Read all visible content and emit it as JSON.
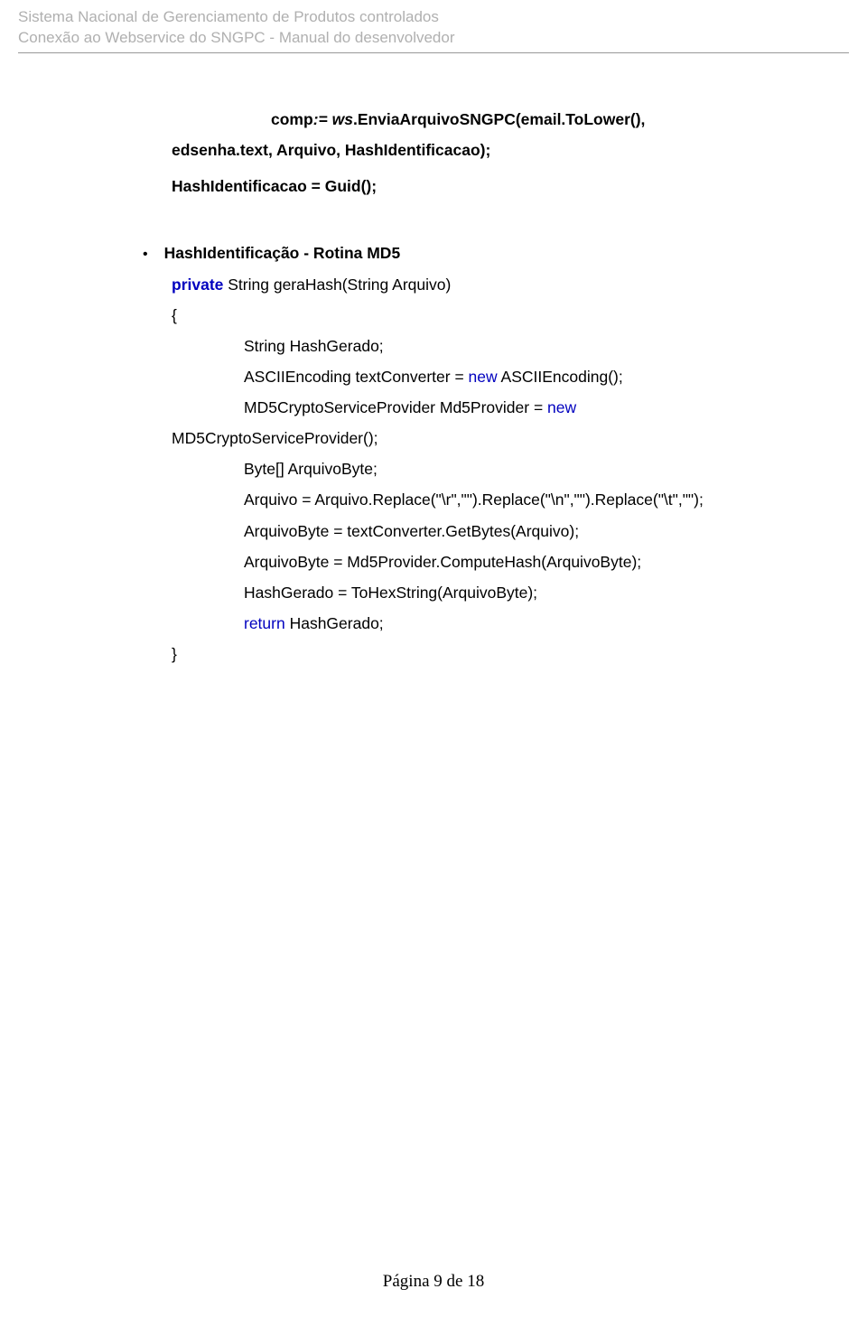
{
  "header": {
    "line1": "Sistema Nacional de Gerenciamento de Produtos controlados",
    "line2": "Conexão ao Webservice do SNGPC - Manual do desenvolvedor"
  },
  "intro": {
    "part1_prefix": "comp",
    "part1_italic": ":= ws",
    "part1_rest": ".EnviaArquivoSNGPC(email.ToLower(),",
    "part2": "edsenha.text, Arquivo, HashIdentificacao);",
    "part3": "HashIdentificacao = Guid();"
  },
  "bullet": {
    "title": "HashIdentificação - Rotina MD5"
  },
  "code": {
    "l1_kw": "private",
    "l1_rest": " String geraHash(String Arquivo)",
    "l2": "{",
    "l3": "String HashGerado;",
    "l4a": "ASCIIEncoding textConverter = ",
    "l4_kw": "new",
    "l4b": " ASCIIEncoding();",
    "l5a": "MD5CryptoServiceProvider Md5Provider = ",
    "l5_kw": "new",
    "l6": "MD5CryptoServiceProvider();",
    "l7": "Byte[] ArquivoByte;",
    "l8": "Arquivo = Arquivo.Replace(\"\\r\",\"\").Replace(\"\\n\",\"\").Replace(\"\\t\",\"\");",
    "l9": "ArquivoByte = textConverter.GetBytes(Arquivo);",
    "l10": "ArquivoByte = Md5Provider.ComputeHash(ArquivoByte);",
    "l11": "HashGerado = ToHexString(ArquivoByte);",
    "l12_kw": "return",
    "l12_rest": " HashGerado;",
    "l13": "}"
  },
  "footer": "Página 9 de 18"
}
